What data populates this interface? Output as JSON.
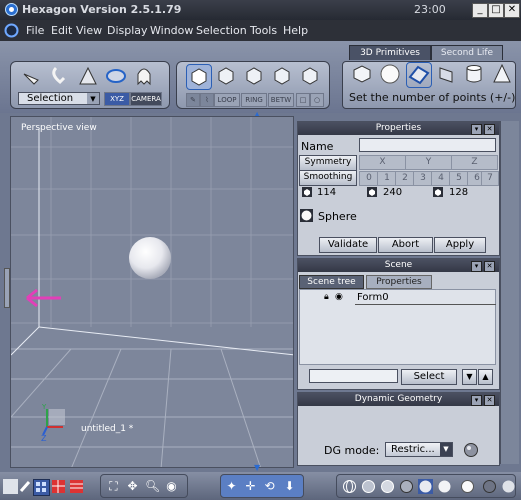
{
  "window": {
    "title": "Hexagon Version 2.5.1.79",
    "clock": "23:00"
  },
  "menu": [
    "File",
    "Edit",
    "View",
    "Display",
    "Window",
    "Selection",
    "Tools",
    "Help"
  ],
  "toolbar": {
    "tabs": [
      "3D Primitives",
      "Second Life"
    ],
    "mode_select": "Selection",
    "xyz_label": "XYZ",
    "camera_label": "CAMERA",
    "edge_buttons": [
      "LOOP",
      "RING",
      "BETW"
    ],
    "hint": "Set the number of points (+/-)"
  },
  "viewport": {
    "label": "Perspective view",
    "object_name": "untitled_1 *"
  },
  "properties": {
    "title": "Properties",
    "name_label": "Name",
    "name_value": "",
    "symmetry_label": "Symmetry",
    "axes": [
      "X",
      "Y",
      "Z"
    ],
    "smoothing_label": "Smoothing",
    "smoothing_levels": [
      "0",
      "1",
      "2",
      "3",
      "4",
      "5",
      "6",
      "7"
    ],
    "counts": [
      "114",
      "240",
      "128"
    ],
    "primitive": "Sphere",
    "validate": "Validate",
    "abort": "Abort",
    "apply": "Apply"
  },
  "scene": {
    "title": "Scene",
    "tabs": [
      "Scene tree",
      "Properties"
    ],
    "item": "Form0",
    "search_value": "",
    "select_label": "Select"
  },
  "dynamic_geometry": {
    "title": "Dynamic Geometry",
    "mode_label": "DG mode:",
    "mode_value": "Restric..."
  }
}
